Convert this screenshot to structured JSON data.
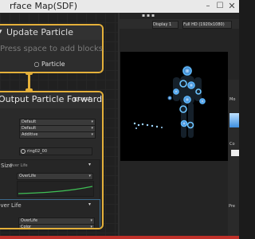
{
  "window": {
    "title": "rface Map(SDF)",
    "min_glyph": "–",
    "max_glyph": "☐",
    "close_glyph": "✕"
  },
  "update_context": {
    "title": "Update Particle",
    "search_hint": "Press space to add blocks",
    "output_label": "Particle"
  },
  "output_context": {
    "title": "Output Particle",
    "subtitle": "Forward Decal",
    "local_label": "Local",
    "blend_mode": "Default",
    "cull_mode": "Default",
    "ztest": "Additive",
    "texture": "ring02_00"
  },
  "size_over_life": {
    "title": "Size",
    "sublabel": "Over Life",
    "mode": "OverLife"
  },
  "color_over_life": {
    "title": "Over Life",
    "mode": "OverLife",
    "channel": "Color"
  },
  "game_view": {
    "display": "Display 1",
    "resolution": "Full HD (1920x1080)"
  },
  "side_panel": {
    "label_mo": "Mo",
    "label_co": "Co",
    "label_pre": "Pre"
  },
  "colors": {
    "context_border": "#e4b03a",
    "gradient_start": "#3a7fd0",
    "gradient_end": "#c7e9ff",
    "glow": "#4aa8ff",
    "accent_red": "#c0312a"
  }
}
